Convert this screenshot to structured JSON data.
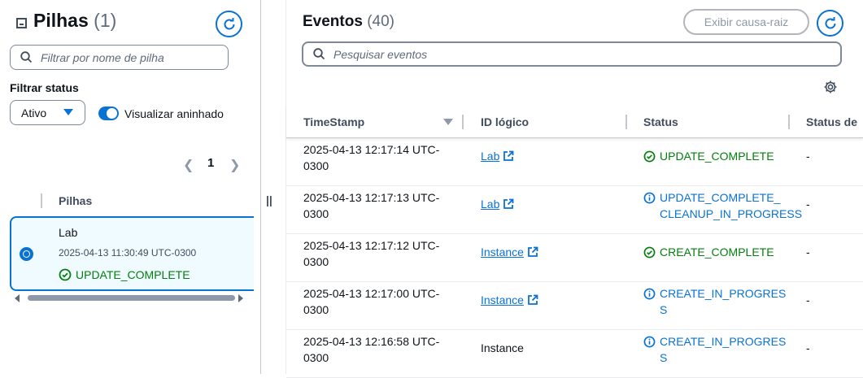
{
  "stacks": {
    "title": "Pilhas",
    "count": "(1)",
    "search_placeholder": "Filtrar por nome de pilha",
    "filter_label": "Filtrar status",
    "filter_value": "Ativo",
    "nested_label": "Visualizar aninhado",
    "page": "1",
    "column": "Pilhas",
    "items": [
      {
        "name": "Lab",
        "time": "2025-04-13 11:30:49 UTC-0300",
        "status": "UPDATE_COMPLETE"
      }
    ]
  },
  "events": {
    "title": "Eventos",
    "count": "(40)",
    "root_cause_button": "Exibir causa-raiz",
    "search_placeholder": "Pesquisar eventos",
    "columns": [
      "TimeStamp",
      "ID lógico",
      "Status",
      "Status de"
    ],
    "rows": [
      {
        "ts1": "2025-04-13 12:17:14 UTC-",
        "ts2": "0300",
        "id": "Lab",
        "link": true,
        "status1": "UPDATE_COMPLETE",
        "status2": "",
        "type": "success",
        "detail": "-"
      },
      {
        "ts1": "2025-04-13 12:17:13 UTC-",
        "ts2": "0300",
        "id": "Lab",
        "link": true,
        "status1": "UPDATE_COMPLETE_",
        "status2": "CLEANUP_IN_PROGRESS",
        "type": "info",
        "detail": "-"
      },
      {
        "ts1": "2025-04-13 12:17:12 UTC-",
        "ts2": "0300",
        "id": "Instance",
        "link": true,
        "status1": "CREATE_COMPLETE",
        "status2": "",
        "type": "success",
        "detail": "-"
      },
      {
        "ts1": "2025-04-13 12:17:00 UTC-",
        "ts2": "0300",
        "id": "Instance",
        "link": true,
        "status1": "CREATE_IN_PROGRES",
        "status2": "S",
        "type": "info",
        "detail": "-"
      },
      {
        "ts1": "2025-04-13 12:16:58 UTC-",
        "ts2": "0300",
        "id": "Instance",
        "link": false,
        "status1": "CREATE_IN_PROGRES",
        "status2": "S",
        "type": "info",
        "detail": "-"
      }
    ]
  },
  "colors": {
    "accent": "#0972d3",
    "success": "#037f0c",
    "text": "#0f141a",
    "muted": "#5f6b7a"
  }
}
